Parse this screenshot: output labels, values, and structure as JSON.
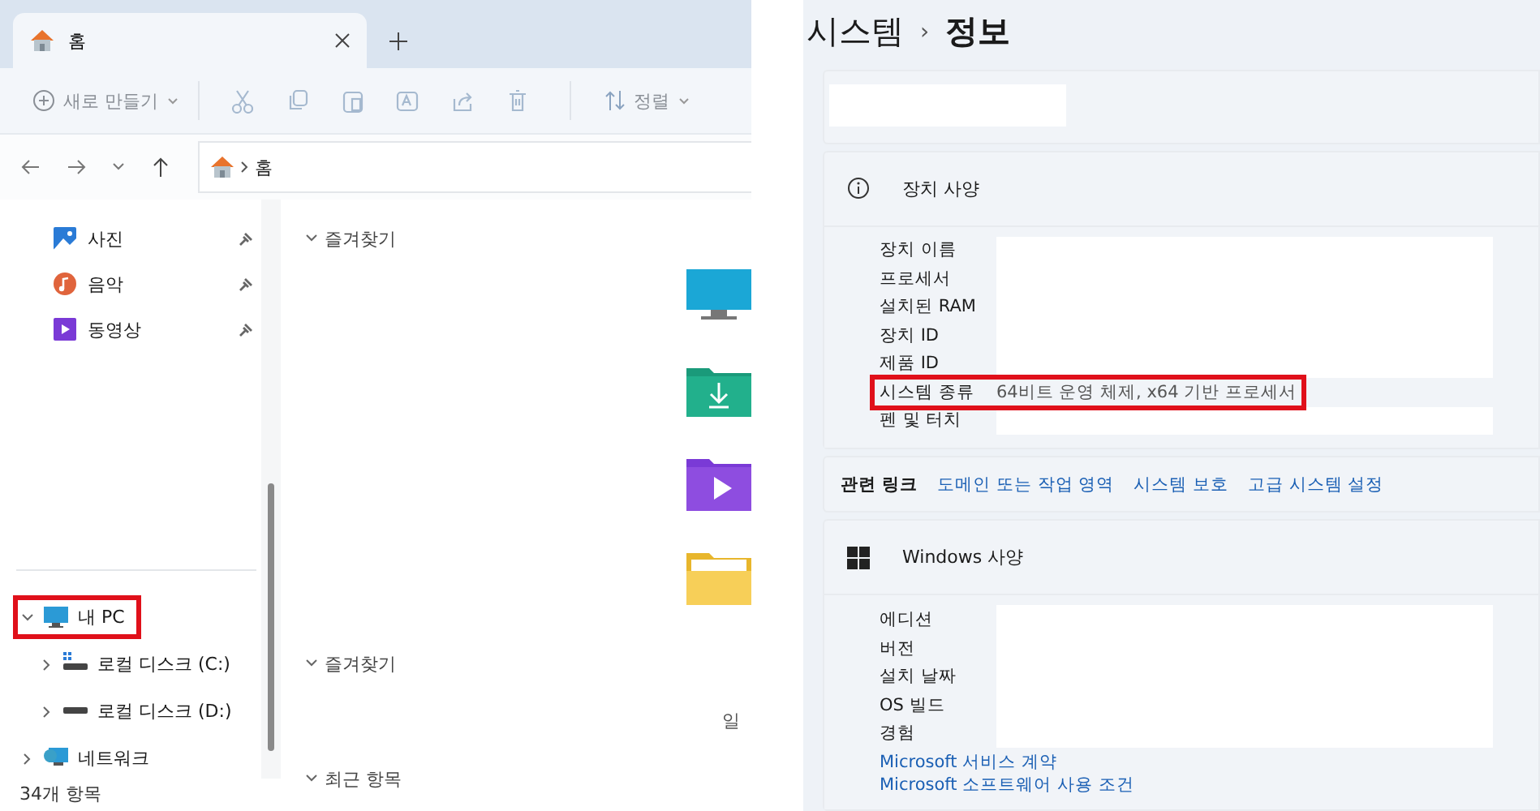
{
  "explorer": {
    "tabs": [
      {
        "label": "홈",
        "selected": true
      }
    ],
    "toolbar": {
      "new_label": "새로 만들기",
      "sort_label": "정렬"
    },
    "address": {
      "path": [
        "홈"
      ]
    },
    "pinned": [
      {
        "label": "사진",
        "kind": "photos"
      },
      {
        "label": "음악",
        "kind": "music"
      },
      {
        "label": "동영상",
        "kind": "videos"
      }
    ],
    "tree": [
      {
        "label": "내 PC",
        "kind": "pc",
        "expanded": true,
        "highlighted": true,
        "children": [
          {
            "label": "로컬 디스크 (C:)",
            "kind": "system-drive",
            "expanded": false,
            "highlighted": false
          },
          {
            "label": "로컬 디스크 (D:)",
            "kind": "drive",
            "expanded": false,
            "highlighted": false
          }
        ]
      },
      {
        "label": "네트워크",
        "kind": "network",
        "expanded": false,
        "highlighted": false
      }
    ],
    "sections": [
      {
        "label": "즐겨찾기",
        "expanded": true,
        "tiles": [
          {
            "kind": "desktop"
          },
          {
            "kind": "downloads"
          },
          {
            "kind": "videos"
          },
          {
            "kind": "documents"
          }
        ]
      },
      {
        "label": "즐겨찾기",
        "expanded": true,
        "text": "일"
      },
      {
        "label": "최근 항목",
        "expanded": true
      }
    ],
    "status": "34개 항목"
  },
  "settings": {
    "breadcrumb": [
      "시스템",
      "정보"
    ],
    "breadcrumb_separator": "›",
    "top_card": {
      "redacted": true
    },
    "device_specs": {
      "title": "장치 사양",
      "rows": [
        {
          "label": "장치 이름",
          "redacted": true,
          "highlighted": false
        },
        {
          "label": "프로세서",
          "redacted": true,
          "highlighted": false
        },
        {
          "label": "설치된 RAM",
          "redacted": true,
          "highlighted": false
        },
        {
          "label": "장치 ID",
          "redacted": true,
          "highlighted": false
        },
        {
          "label": "제품 ID",
          "redacted": true,
          "highlighted": false
        },
        {
          "label": "시스템 종류",
          "value": "64비트 운영 체제, x64 기반 프로세서",
          "redacted": false,
          "highlighted": true
        },
        {
          "label": "펜 및 터치",
          "redacted": true,
          "highlighted": false
        }
      ]
    },
    "related": {
      "label": "관련 링크",
      "links": [
        "도메인 또는 작업 영역",
        "시스템 보호",
        "고급 시스템 설정"
      ]
    },
    "windows_specs": {
      "title": "Windows 사양",
      "rows": [
        {
          "label": "에디션",
          "redacted": true,
          "highlighted": false
        },
        {
          "label": "버전",
          "redacted": true,
          "highlighted": false
        },
        {
          "label": "설치 날짜",
          "redacted": true,
          "highlighted": false
        },
        {
          "label": "OS 빌드",
          "redacted": true,
          "highlighted": false
        },
        {
          "label": "경험",
          "redacted": true,
          "highlighted": false
        }
      ],
      "links": [
        "Microsoft 서비스 계약",
        "Microsoft 소프트웨어 사용 조건"
      ]
    }
  }
}
